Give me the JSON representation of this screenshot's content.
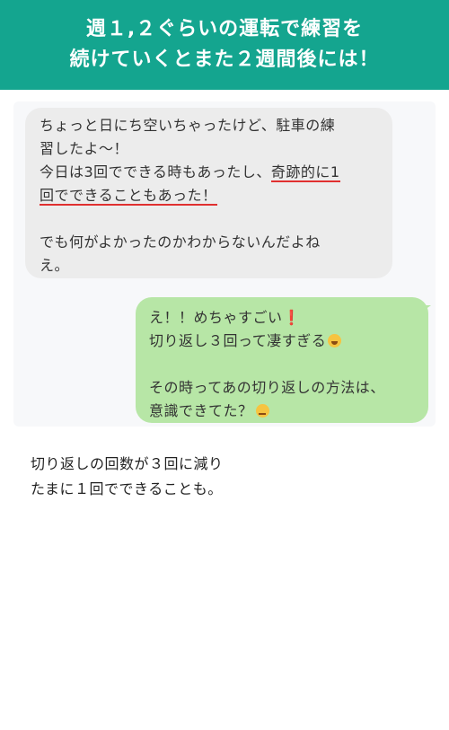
{
  "header": {
    "line1": "週１,２ぐらいの運転で練習を",
    "line2": "続けていくとまた２週間後には！"
  },
  "chat": {
    "incoming": {
      "line1": "ちょっと日にち空いちゃったけど、駐車の練",
      "line2": "習したよ〜！",
      "line3_pre": "今日は3回でできる時もあったし、",
      "line3_ul": "奇跡的に1",
      "line4_ul": "回でできることもあった！",
      "line5": "でも何がよかったのかわからないんだよね",
      "line6": "え。"
    },
    "outgoing": {
      "line1": "え！！めちゃすごい",
      "line1_mark": "❗",
      "line2": "切り返し３回って凄すぎる",
      "line2_emoji": "laughing-face",
      "line3": "その時ってあの切り返しの方法は、",
      "line4": "意識できてた？",
      "line4_emoji": "thinking-face"
    }
  },
  "caption": {
    "line1": "切り返しの回数が３回に減り",
    "line2": "たまに１回でできることも。"
  }
}
